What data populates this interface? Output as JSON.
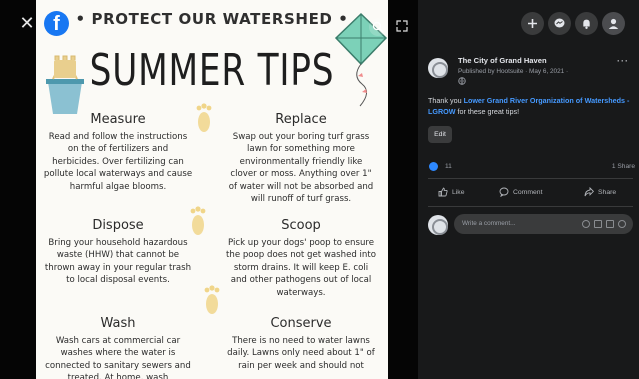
{
  "poster": {
    "header": "• PROTECT OUR WATERSHED •",
    "title": "SUMMER TIPS",
    "tips": [
      {
        "title": "Measure",
        "body": "Read and follow the instructions on the of fertilizers and herbicides. Over fertilizing can pollute local waterways and cause harmful algae blooms."
      },
      {
        "title": "Replace",
        "body": "Swap out your boring turf grass lawn for something more environmentally friendly like clover or moss. Anything over 1\" of water will not be absorbed and will runoff of turf grass."
      },
      {
        "title": "Dispose",
        "body": "Bring your household hazardous waste (HHW) that cannot be thrown away in your regular trash to local disposal events."
      },
      {
        "title": "Scoop",
        "body": "Pick up your dogs' poop to ensure the poop does not get washed into storm drains. It will keep E. coli and other pathogens out of local waterways."
      },
      {
        "title": "Wash",
        "body": "Wash cars at commercial car washes where the water is connected to sanitary sewers and treated. At home, wash"
      },
      {
        "title": "Conserve",
        "body": "There is no need to water lawns daily. Lawns only need about 1\" of rain per week and should not"
      }
    ]
  },
  "viewer": {
    "close_icon": "close-icon",
    "brand_letter": "f",
    "zoom_icon": "zoom-icon",
    "fullscreen_icon": "fullscreen-icon"
  },
  "topbar": {
    "buttons": [
      "plus-icon",
      "messenger-icon",
      "bell-icon",
      "account-icon"
    ]
  },
  "post": {
    "author": "The City of Grand Haven",
    "meta": "Published by Hootsuite ·  May 6, 2021 ·",
    "text_before": "Thank you ",
    "mention": "Lower Grand River Organization of Watersheds - LGROW",
    "text_after": " for these great tips!",
    "edit_label": "Edit",
    "more_label": "···",
    "reaction_count": "11",
    "shares": "1 Share"
  },
  "actions": {
    "like": "Like",
    "comment": "Comment",
    "share": "Share"
  },
  "comment": {
    "placeholder": "Write a comment..."
  },
  "colors": {
    "accent": "#2d88ff",
    "mention": "#4599ff",
    "sidebar_bg": "#18191a",
    "poster_bg": "#fbfaf6"
  }
}
